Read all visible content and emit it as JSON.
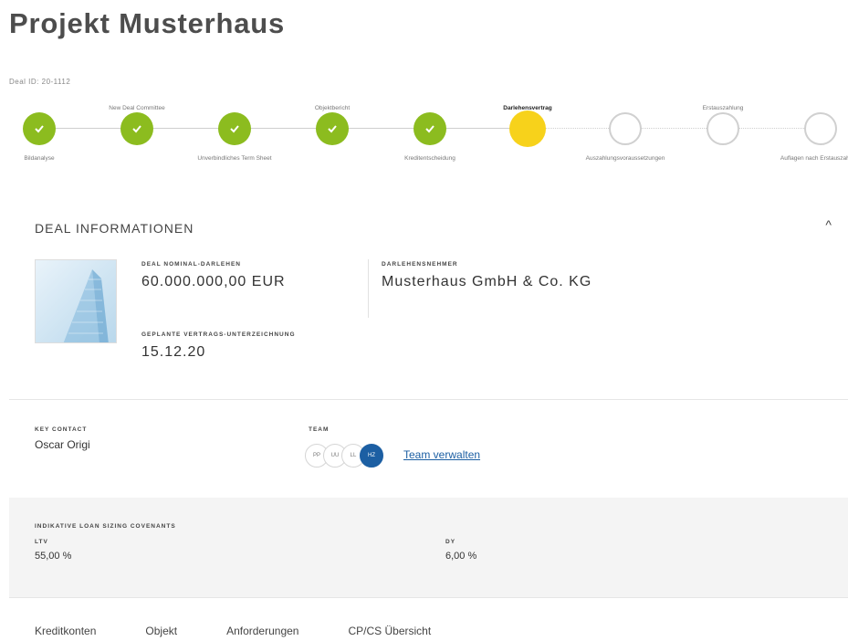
{
  "header": {
    "title": "Projekt Musterhaus",
    "deal_id": "Deal ID: 20-1112"
  },
  "stepper": {
    "steps": [
      {
        "top_label": "",
        "bottom_label": "Bildanalyse",
        "status": "done"
      },
      {
        "top_label": "New Deal Committee",
        "bottom_label": "",
        "status": "done"
      },
      {
        "top_label": "",
        "bottom_label": "Unverbindliches Term Sheet",
        "status": "done"
      },
      {
        "top_label": "Objektbericht",
        "bottom_label": "",
        "status": "done"
      },
      {
        "top_label": "",
        "bottom_label": "Kreditentscheidung",
        "status": "done"
      },
      {
        "top_label": "Darlehensvertrag",
        "bottom_label": "",
        "status": "current"
      },
      {
        "top_label": "",
        "bottom_label": "Auszahlungsvoraussetzungen",
        "status": "todo"
      },
      {
        "top_label": "Erstauszahlung",
        "bottom_label": "",
        "status": "todo"
      },
      {
        "top_label": "",
        "bottom_label": "Auflagen nach Erstauszahlung",
        "status": "todo"
      }
    ]
  },
  "deal_info": {
    "title": "DEAL INFORMATIONEN",
    "collapse_glyph": "^",
    "nominal_label": "DEAL NOMINAL-DARLEHEN",
    "nominal_value": "60.000.000,00 EUR",
    "borrower_label": "DARLEHENSNEHMER",
    "borrower_value": "Musterhaus GmbH & Co. KG",
    "signing_label": "GEPLANTE VERTRAGS-UNTERZEICHNUNG",
    "signing_value": "15.12.20"
  },
  "contact": {
    "key_contact_label": "KEY CONTACT",
    "key_contact_name": "Oscar Origi",
    "team_label": "TEAM",
    "team_members": [
      "PP",
      "UU",
      "LL",
      "HZ"
    ],
    "team_link": "Team verwalten"
  },
  "covenants": {
    "title": "INDIKATIVE LOAN SIZING COVENANTS",
    "ltv_label": "LTV",
    "ltv_value": "55,00 %",
    "dy_label": "DY",
    "dy_value": "6,00 %"
  },
  "tabs": [
    "Kreditkonten",
    "Objekt",
    "Anforderungen",
    "CP/CS Übersicht"
  ],
  "colors": {
    "done": "#8cbc1f",
    "current": "#f7d21b",
    "link": "#1c5fa3"
  }
}
